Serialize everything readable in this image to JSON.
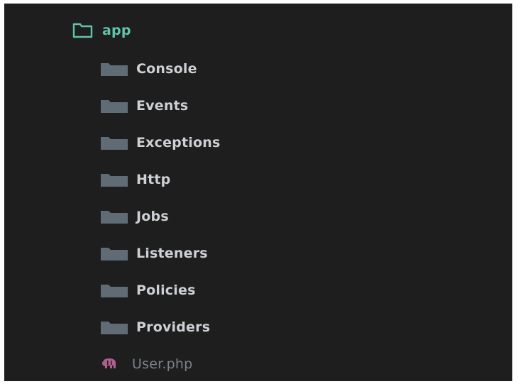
{
  "colors": {
    "background": "#1e1e1e",
    "root_accent": "#5fc4aa",
    "folder_fill": "#5f6c76",
    "folder_text": "#cdd0d4",
    "file_icon": "#b15e8e",
    "file_text": "#7b8289"
  },
  "tree": {
    "root": {
      "label": "app",
      "icon": "folder-outline-icon",
      "expanded": true
    },
    "children": [
      {
        "label": "Console",
        "type": "folder",
        "icon": "folder-icon"
      },
      {
        "label": "Events",
        "type": "folder",
        "icon": "folder-icon"
      },
      {
        "label": "Exceptions",
        "type": "folder",
        "icon": "folder-icon"
      },
      {
        "label": "Http",
        "type": "folder",
        "icon": "folder-icon"
      },
      {
        "label": "Jobs",
        "type": "folder",
        "icon": "folder-icon"
      },
      {
        "label": "Listeners",
        "type": "folder",
        "icon": "folder-icon"
      },
      {
        "label": "Policies",
        "type": "folder",
        "icon": "folder-icon"
      },
      {
        "label": "Providers",
        "type": "folder",
        "icon": "folder-icon"
      },
      {
        "label": "User.php",
        "type": "file",
        "icon": "php-elephant-icon"
      }
    ]
  }
}
